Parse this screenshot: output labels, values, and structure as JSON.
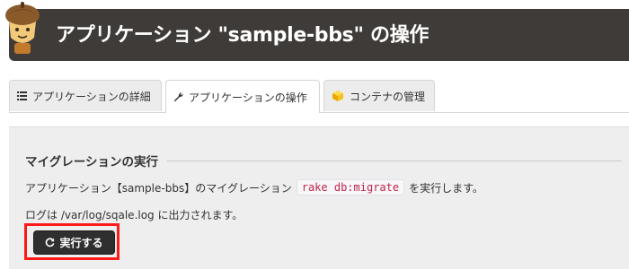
{
  "header": {
    "title": "アプリケーション \"sample-bbs\" の操作",
    "logo_icon": "acorn-mascot-icon"
  },
  "tabs": [
    {
      "label": "アプリケーションの詳細",
      "icon": "list-icon",
      "active": false
    },
    {
      "label": "アプリケーションの操作",
      "icon": "wrench-icon",
      "active": true
    },
    {
      "label": "コンテナの管理",
      "icon": "cube-icon",
      "active": false
    }
  ],
  "section": {
    "title": "マイグレーションの実行",
    "desc_before": "アプリケーション【sample-bbs】のマイグレーション",
    "command": "rake db:migrate",
    "desc_after": "を実行します。",
    "log_text": "ログは /var/log/sqale.log に出力されます。",
    "run_button_label": "実行する",
    "run_icon": "refresh-icon"
  },
  "colors": {
    "header_bg": "#3e3b38",
    "highlight": "#ff1a1a",
    "code_text": "#c0254a",
    "button_bg": "#2f2f2f"
  }
}
